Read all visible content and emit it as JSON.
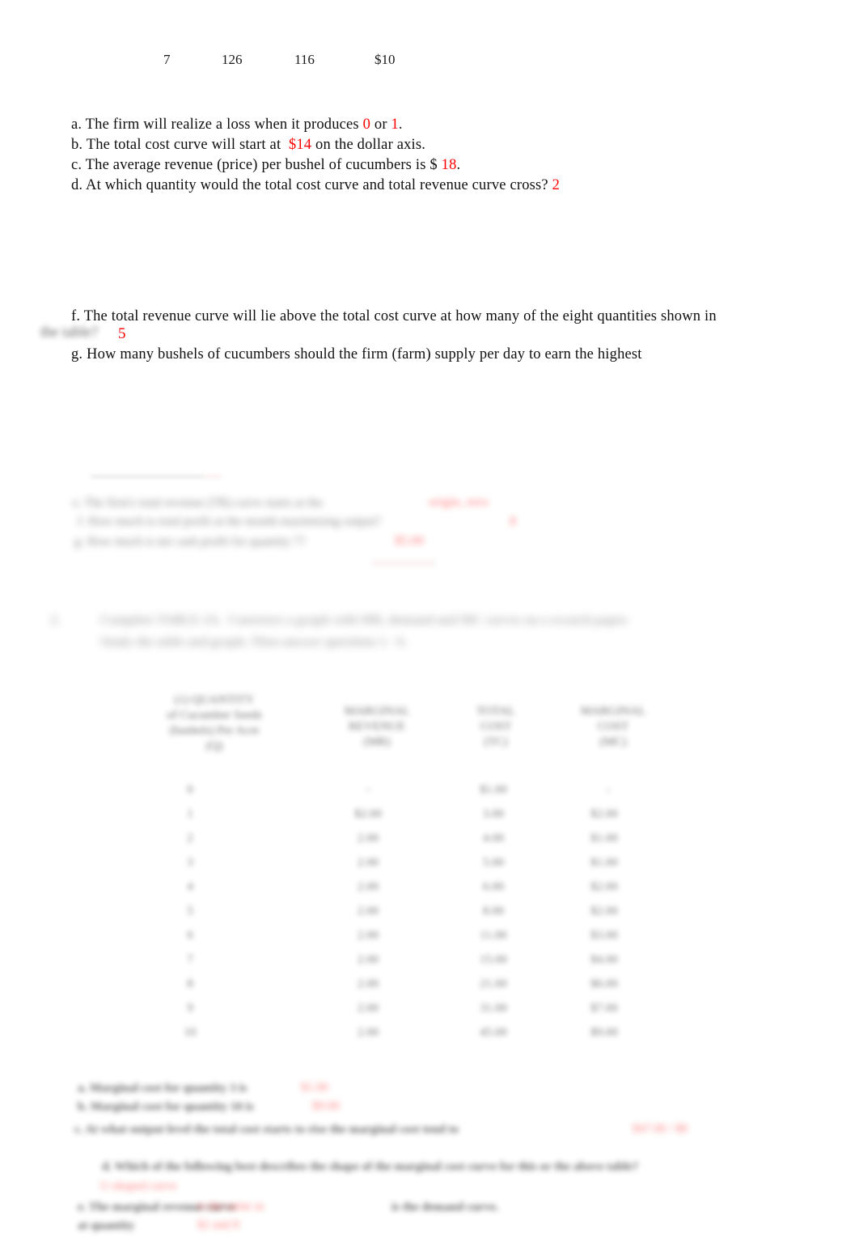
{
  "document": {
    "type": "economics-worksheet",
    "page_background": "#ffffff",
    "answer_color": "#fe0000",
    "text_color": "#100f0f"
  },
  "top_row": {
    "values": [
      "7",
      "126",
      "116",
      "$10"
    ]
  },
  "questions": {
    "a": {
      "prefix": "a. The firm will realize a loss when it produces ",
      "answer1": "0",
      "middle": " or ",
      "answer2": "1",
      "suffix": "."
    },
    "b": {
      "prefix": "b. The total cost curve will start at  ",
      "answer": "$14",
      "suffix": " on the dollar axis."
    },
    "c": {
      "prefix": "c. The average revenue (price) per bushel of cucumbers is $ ",
      "answer": "18",
      "suffix": "."
    },
    "d": {
      "prefix": "d. At which quantity would the total cost curve and total revenue curve cross? ",
      "answer": "2"
    },
    "f": {
      "line1": "f. The total revenue curve will lie above the total cost curve at how many of the eight quantities shown in",
      "line2_redacted": "the table?",
      "answer": "5"
    },
    "g": {
      "line1": "g. How many bushels of cucumbers should the firm (farm) supply per day to earn the highest"
    }
  },
  "redacted_block_1": {
    "note": "blurred answer lines e/h/i with red answers",
    "lines": [
      "e. The firm's total revenue (TR) curve starts at the",
      "f. How much is total profit at the month maximizing output?",
      "g. How much is net cash profit for quantity 7?"
    ],
    "red_answers": [
      "origin, zero",
      "8",
      "$5.00"
    ]
  },
  "redacted_heading": {
    "number": "2.",
    "line1": "Complete TABLE 2A.  Construct a graph with MR, demand and MC curves on a scratch paper.",
    "line2": "Study the table and graph. Then answer questions 1 - 6."
  },
  "table": {
    "headers": [
      "(1) QUANTITY\nof Cucumber Seeds\n(bushels) Per Acre\n(Q)",
      "MARGINAL\nREVENUE\n(MR)",
      "TOTAL\nCOST\n(TC)",
      "MARGINAL\nCOST\n(MC)"
    ],
    "rows": [
      [
        "0",
        "-",
        "$1.00",
        "-"
      ],
      [
        "1",
        "$2.00",
        "3.00",
        "$2.00"
      ],
      [
        "2",
        "2.00",
        "4.00",
        "$1.00"
      ],
      [
        "3",
        "2.00",
        "5.00",
        "$1.00"
      ],
      [
        "4",
        "2.00",
        "6.00",
        "$2.00"
      ],
      [
        "5",
        "2.00",
        "8.00",
        "$2.00"
      ],
      [
        "6",
        "2.00",
        "11.00",
        "$3.00"
      ],
      [
        "7",
        "2.00",
        "15.00",
        "$4.00"
      ],
      [
        "8",
        "2.00",
        "21.00",
        "$6.00"
      ],
      [
        "9",
        "2.00",
        "31.00",
        "$7.00"
      ],
      [
        "10",
        "2.00",
        "45.00",
        "$9.00"
      ]
    ]
  },
  "redacted_block_2": {
    "lines": [
      "a. Marginal cost for quantity 3 is",
      "b. Marginal cost for quantity 10 is",
      "c. At what output level the total cost starts to rise the marginal cost tend to"
    ],
    "red_answers": [
      "$1.00",
      "$9.00",
      "$47.00 / $8"
    ]
  },
  "redacted_block_3": {
    "lines": [
      "d. Which of the following best describes the shape of the marginal cost curve for this or the above table?",
      "e. The marginal revenue curve",
      "at quantity",
      "is the demand curve."
    ],
    "red_answers": [
      "U-shaped curve",
      "is the same as",
      "$2 and 8"
    ]
  }
}
